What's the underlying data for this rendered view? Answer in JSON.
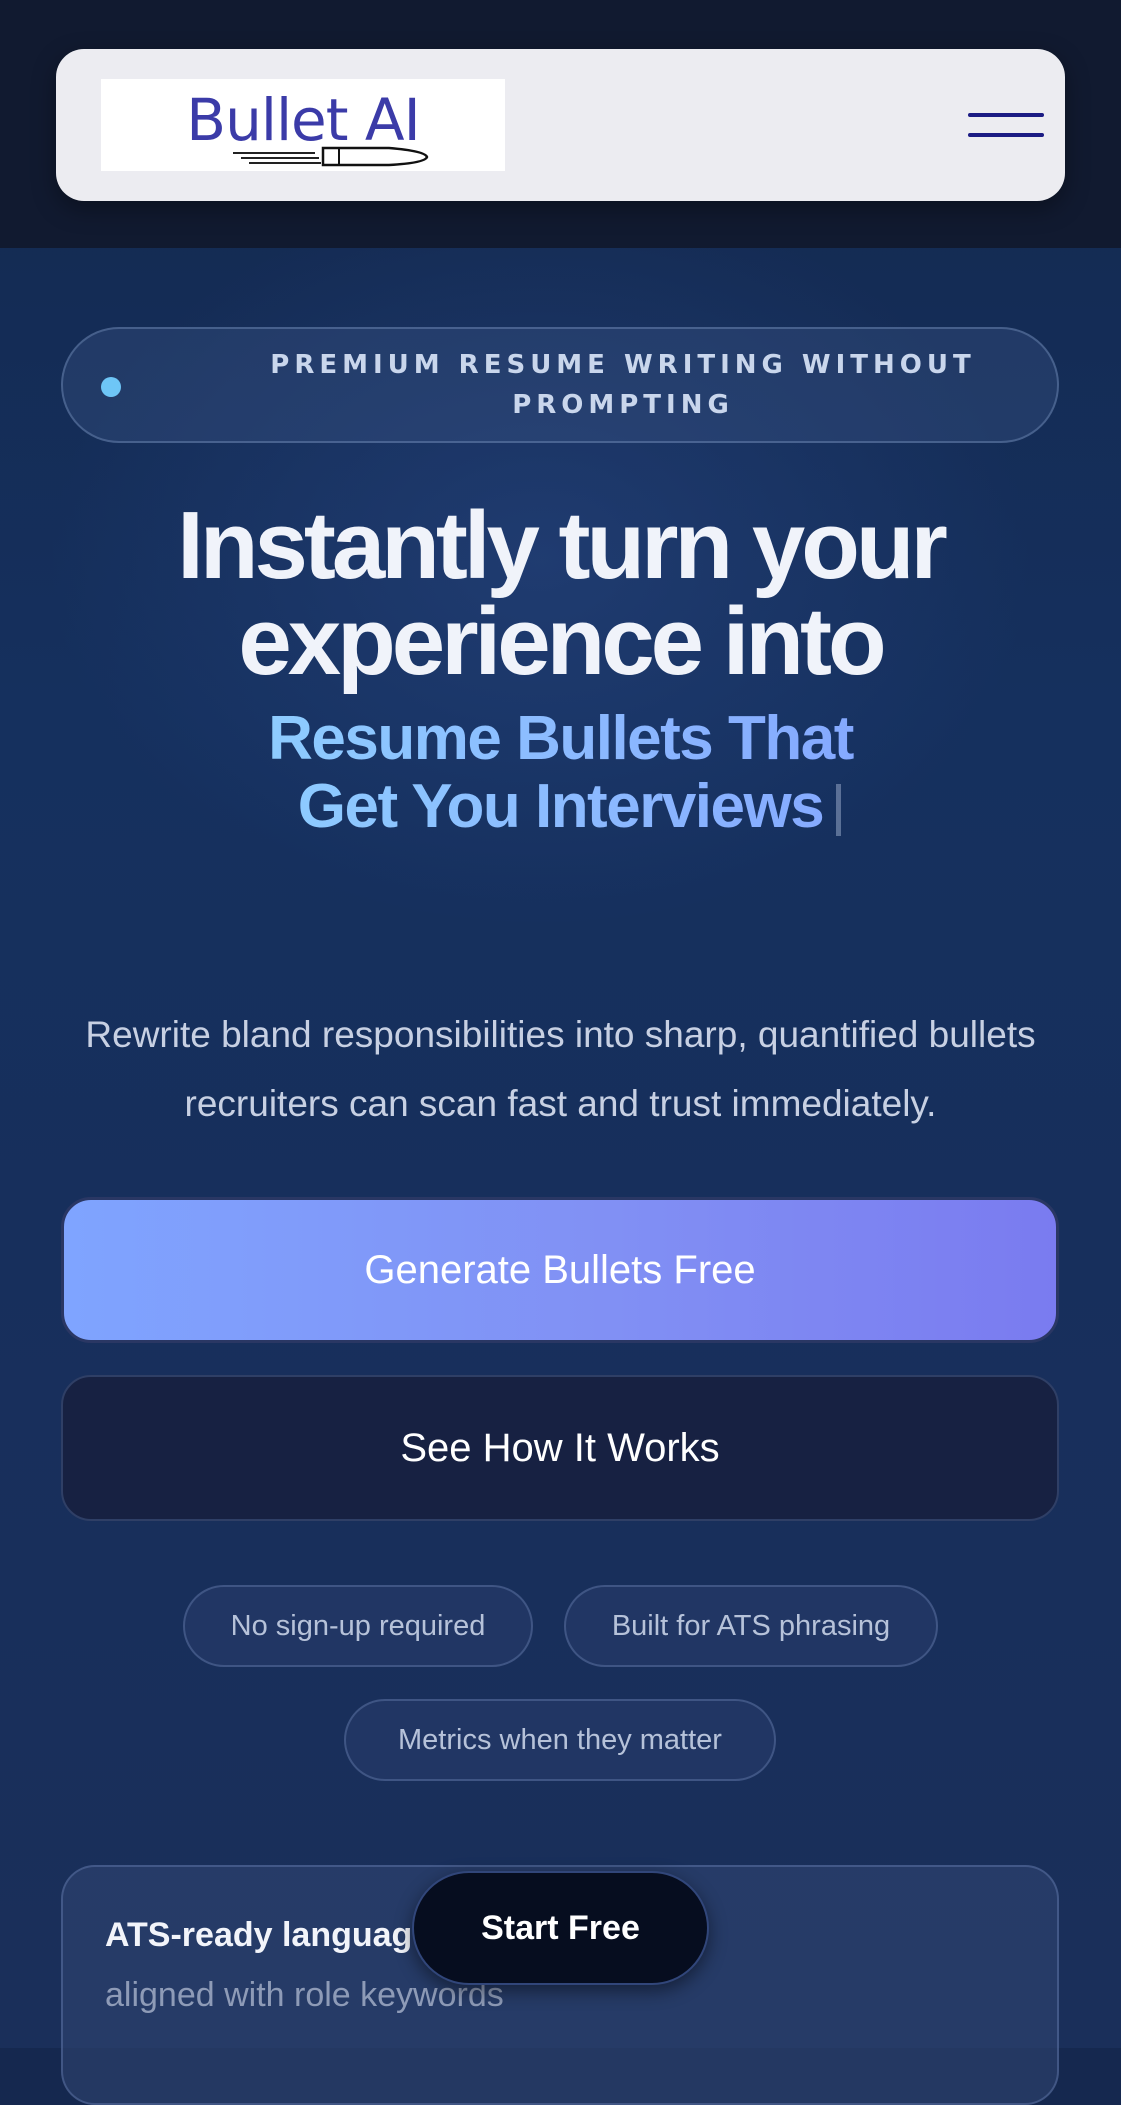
{
  "header": {
    "logo_text": "Bullet AI",
    "menu_icon": "hamburger-menu-icon"
  },
  "hero": {
    "badge_text": "PREMIUM RESUME WRITING WITHOUT PROMPTING",
    "headline_line1": "Instantly turn your",
    "headline_line2": "experience into",
    "accent_line1": "Resume Bullets That",
    "accent_line2": "Get You Interviews",
    "subtitle": "Rewrite bland responsibilities into sharp, quantified bullets recruiters can scan fast and trust immediately."
  },
  "actions": {
    "primary_label": "Generate Bullets Free",
    "secondary_label": "See How It Works"
  },
  "chips": [
    "No sign-up required",
    "Built for ATS phrasing",
    "Metrics when they matter"
  ],
  "feature_card": {
    "title": "ATS-ready language",
    "description": "aligned with role keywords"
  },
  "floating_cta": {
    "label": "Start Free"
  },
  "colors": {
    "background": "#15284f",
    "topbar": "#111a30",
    "nav_card": "#ececf1",
    "logo": "#3b3ba8",
    "badge_dot": "#6ec6f7",
    "accent_gradient_start": "#8fd8ff",
    "accent_gradient_end": "#7f9cff",
    "primary_button_start": "#7fa4ff",
    "primary_button_end": "#7a7bf0",
    "secondary_button": "#172142",
    "floating_cta": "#060d1f"
  }
}
